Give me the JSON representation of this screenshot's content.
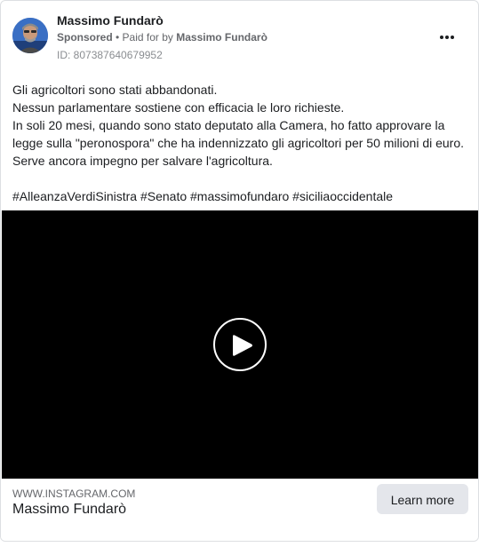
{
  "post": {
    "author": "Massimo Fundarò",
    "sponsored_label": "Sponsored",
    "separator": " • ",
    "paid_for_prefix": "Paid for by ",
    "paid_for_name": "Massimo Fundarò",
    "ad_id": "ID: 807387640679952",
    "more_icon": "more-horizontal-icon"
  },
  "body": {
    "lines": [
      "Gli agricoltori sono stati abbandonati.",
      "Nessun parlamentare sostiene con efficacia le loro richieste.",
      "In soli 20 mesi, quando sono stato deputato alla Camera, ho fatto approvare la",
      "legge sulla \"peronospora\" che ha indennizzato gli agricoltori per 50 milioni di euro.",
      "Serve ancora impegno per salvare l'agricoltura.",
      "#AlleanzaVerdiSinistra #Senato #massimofundaro #siciliaoccidentale"
    ]
  },
  "video": {
    "play_icon": "play-icon",
    "background_color": "#000000"
  },
  "link": {
    "domain": "WWW.INSTAGRAM.COM",
    "title": "Massimo Fundarò",
    "cta_label": "Learn more"
  },
  "colors": {
    "text_primary": "#1c1e21",
    "text_secondary": "#65676b",
    "button_bg": "#e4e6eb"
  }
}
